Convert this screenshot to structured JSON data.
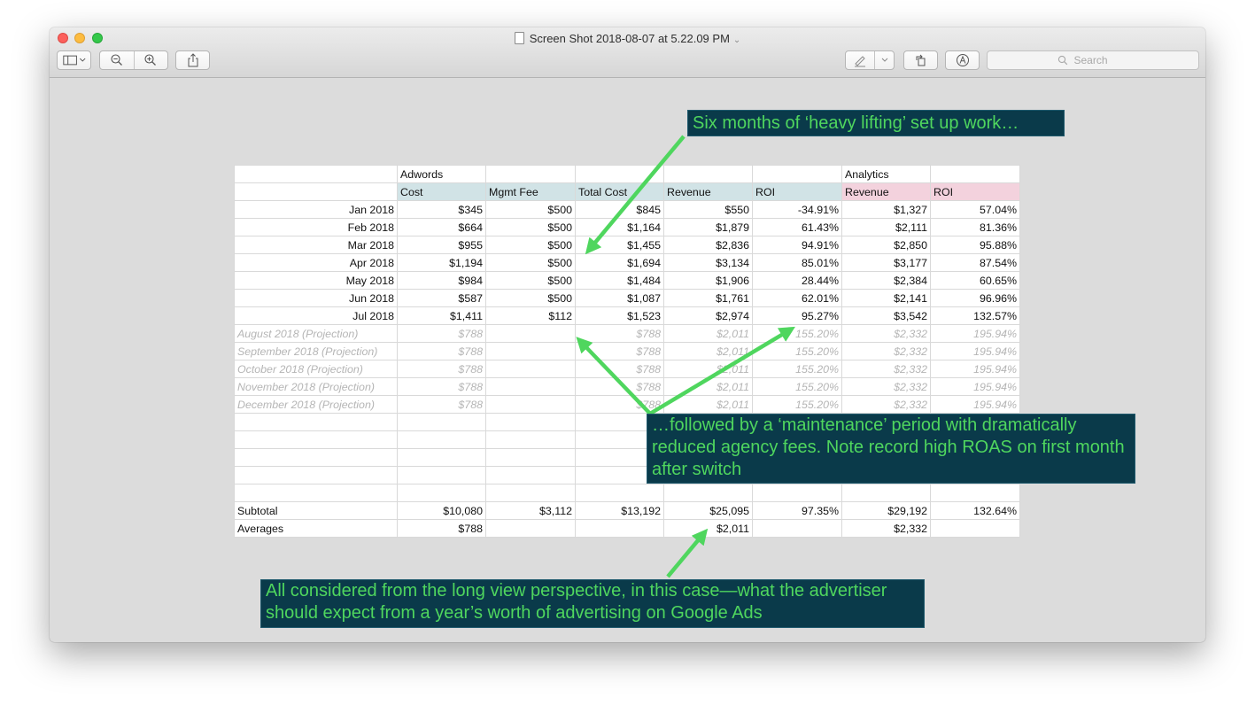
{
  "window": {
    "title": "Screen Shot 2018-08-07 at 5.22.09 PM",
    "search_placeholder": "Search"
  },
  "colors": {
    "accent_green": "#4fd65e",
    "note_bg": "#0a3a4a",
    "header_blue": "#d1e3e6",
    "header_pink": "#f3d2dd"
  },
  "table": {
    "group_row": [
      "",
      "Adwords",
      "",
      "",
      "",
      "",
      "Analytics",
      ""
    ],
    "header_row": [
      "",
      "Cost",
      "Mgmt Fee",
      "Total Cost",
      "Revenue",
      "ROI",
      "Revenue",
      "ROI"
    ],
    "rows": [
      [
        "Jan 2018",
        "$345",
        "$500",
        "$845",
        "$550",
        "-34.91%",
        "$1,327",
        "57.04%"
      ],
      [
        "Feb 2018",
        "$664",
        "$500",
        "$1,164",
        "$1,879",
        "61.43%",
        "$2,111",
        "81.36%"
      ],
      [
        "Mar 2018",
        "$955",
        "$500",
        "$1,455",
        "$2,836",
        "94.91%",
        "$2,850",
        "95.88%"
      ],
      [
        "Apr 2018",
        "$1,194",
        "$500",
        "$1,694",
        "$3,134",
        "85.01%",
        "$3,177",
        "87.54%"
      ],
      [
        "May 2018",
        "$984",
        "$500",
        "$1,484",
        "$1,906",
        "28.44%",
        "$2,384",
        "60.65%"
      ],
      [
        "Jun 2018",
        "$587",
        "$500",
        "$1,087",
        "$1,761",
        "62.01%",
        "$2,141",
        "96.96%"
      ],
      [
        "Jul 2018",
        "$1,411",
        "$112",
        "$1,523",
        "$2,974",
        "95.27%",
        "$3,542",
        "132.57%"
      ]
    ],
    "projection_rows": [
      [
        "August 2018 (Projection)",
        "$788",
        "",
        "$788",
        "$2,011",
        "155.20%",
        "$2,332",
        "195.94%"
      ],
      [
        "September 2018 (Projection)",
        "$788",
        "",
        "$788",
        "$2,011",
        "155.20%",
        "$2,332",
        "195.94%"
      ],
      [
        "October 2018 (Projection)",
        "$788",
        "",
        "$788",
        "$2,011",
        "155.20%",
        "$2,332",
        "195.94%"
      ],
      [
        "November 2018 (Projection)",
        "$788",
        "",
        "$788",
        "$2,011",
        "155.20%",
        "$2,332",
        "195.94%"
      ],
      [
        "December 2018 (Projection)",
        "$788",
        "",
        "$788",
        "$2,011",
        "155.20%",
        "$2,332",
        "195.94%"
      ]
    ],
    "blank_rows": 5,
    "summary_rows": [
      [
        "Subtotal",
        "$10,080",
        "$3,112",
        "$13,192",
        "$25,095",
        "97.35%",
        "$29,192",
        "132.64%"
      ],
      [
        "Averages",
        "$788",
        "",
        "",
        "$2,011",
        "",
        "$2,332",
        ""
      ]
    ]
  },
  "annotations": {
    "top": "Six months of ‘heavy lifting’ set up work…",
    "middle": "…followed by a ‘maintenance’ period with dramatically reduced agency fees. Note record high ROAS on first month after switch",
    "bottom": "All considered from the long view perspective, in this case—what the advertiser should expect from a year’s worth of advertising on Google Ads"
  }
}
